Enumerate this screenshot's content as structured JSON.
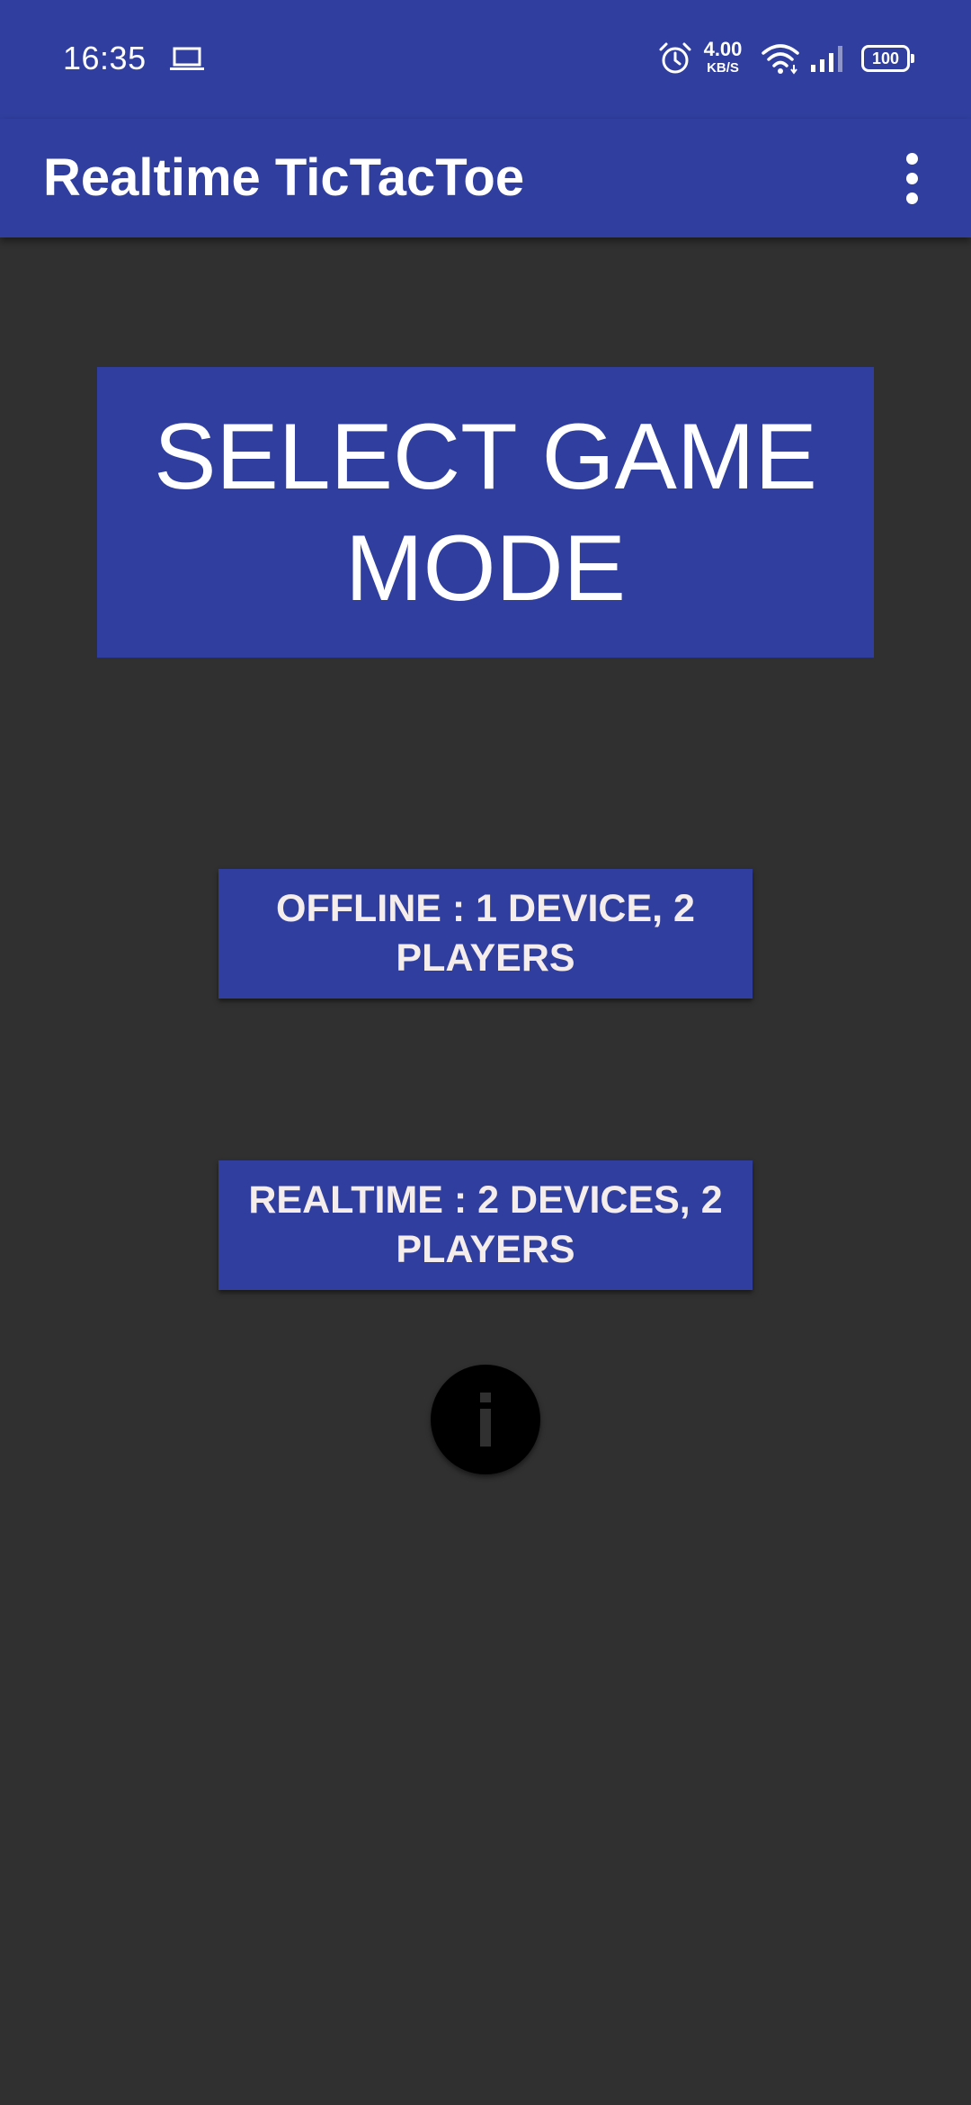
{
  "status_bar": {
    "time": "16:35",
    "net_speed_value": "4.00",
    "net_speed_unit": "KB/S",
    "battery_level": "100",
    "icons": [
      "laptop-icon",
      "alarm-icon",
      "wifi-icon",
      "signal-icon",
      "battery-icon"
    ]
  },
  "app_bar": {
    "title": "Realtime TicTacToe",
    "overflow_icon": "more-vert-icon"
  },
  "main": {
    "heading": "SELECT GAME MODE",
    "offline_button": "OFFLINE : 1 DEVICE, 2 PLAYERS",
    "realtime_button": "REALTIME : 2 DEVICES, 2 PLAYERS",
    "info_icon": "info-icon"
  },
  "colors": {
    "primary": "#303f9f",
    "background": "#303030",
    "button_text": "#f5ecec",
    "fab": "#000000",
    "fab_icon": "#303030"
  }
}
